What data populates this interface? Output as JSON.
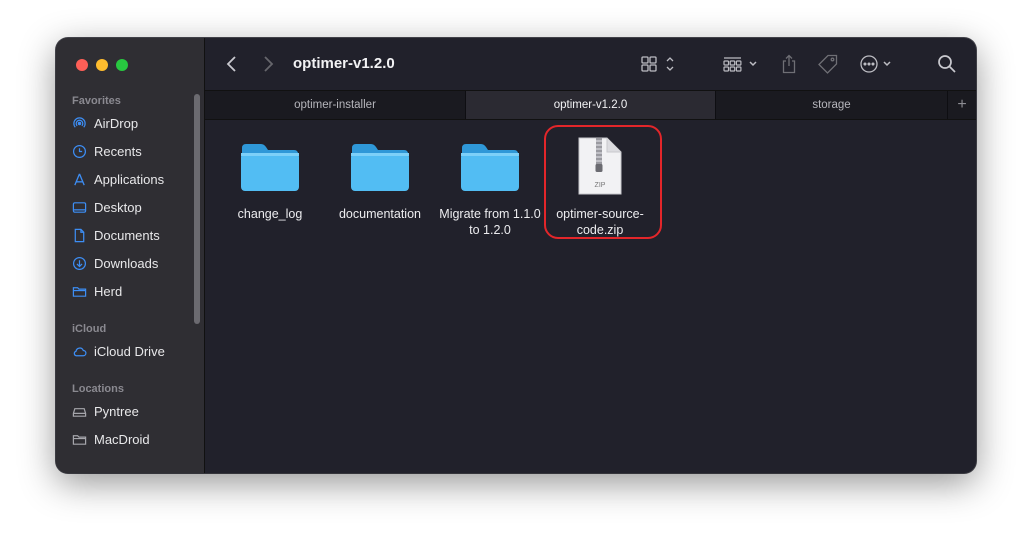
{
  "window": {
    "title": "optimer-v1.2.0"
  },
  "sidebar": {
    "sections": [
      {
        "heading": "Favorites",
        "items": [
          {
            "label": "AirDrop",
            "icon": "airdrop-icon"
          },
          {
            "label": "Recents",
            "icon": "clock-icon"
          },
          {
            "label": "Applications",
            "icon": "applications-icon"
          },
          {
            "label": "Desktop",
            "icon": "desktop-icon"
          },
          {
            "label": "Documents",
            "icon": "document-icon"
          },
          {
            "label": "Downloads",
            "icon": "download-icon"
          },
          {
            "label": "Herd",
            "icon": "folder-icon"
          }
        ]
      },
      {
        "heading": "iCloud",
        "items": [
          {
            "label": "iCloud Drive",
            "icon": "cloud-icon"
          }
        ]
      },
      {
        "heading": "Locations",
        "items": [
          {
            "label": "Pyntree",
            "icon": "drive-icon"
          },
          {
            "label": "MacDroid",
            "icon": "folder-icon"
          }
        ]
      }
    ]
  },
  "tabs": [
    {
      "label": "optimer-installer",
      "active": false
    },
    {
      "label": "optimer-v1.2.0",
      "active": true
    },
    {
      "label": "storage",
      "active": false
    }
  ],
  "files": [
    {
      "name": "change_log",
      "kind": "folder"
    },
    {
      "name": "documentation",
      "kind": "folder"
    },
    {
      "name": "Migrate from 1.1.0 to 1.2.0",
      "kind": "folder"
    },
    {
      "name": "optimer-source-code.zip",
      "kind": "zip",
      "badge": "ZIP",
      "selected": true
    }
  ],
  "colors": {
    "folder": "#4fb8f0",
    "highlight": "#e3262a",
    "accent_blue": "#3d8ef5"
  }
}
